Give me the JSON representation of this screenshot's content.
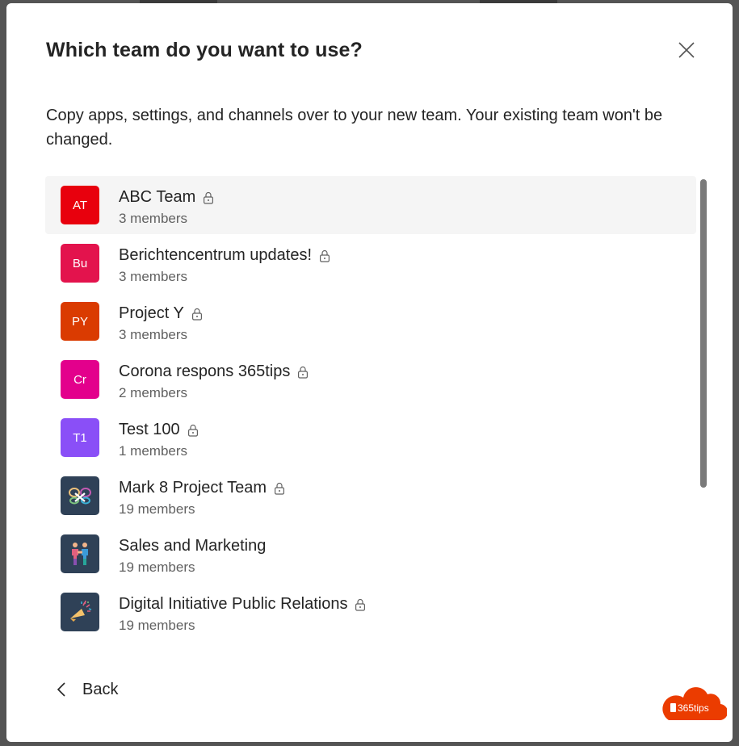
{
  "dialog": {
    "title": "Which team do you want to use?",
    "description": "Copy apps, settings, and channels over to your new team. Your existing team won't be changed.",
    "close_icon": "close-icon",
    "back_label": "Back",
    "back_icon": "chevron-left-icon"
  },
  "teams": [
    {
      "name": "ABC Team",
      "members": "3 members",
      "initials": "AT",
      "color": "#e8000d",
      "private": true,
      "selected": true
    },
    {
      "name": "Berichtencentrum updates!",
      "members": "3 members",
      "initials": "Bu",
      "color": "#e3134d",
      "private": true
    },
    {
      "name": "Project Y",
      "members": "3 members",
      "initials": "PY",
      "color": "#da3b01",
      "private": true
    },
    {
      "name": "Corona respons 365tips",
      "members": "2 members",
      "initials": "Cr",
      "color": "#e3008c",
      "private": true
    },
    {
      "name": "Test 100",
      "members": "1 members",
      "initials": "T1",
      "color": "#8a4ff7",
      "private": true
    },
    {
      "name": "Mark 8 Project Team",
      "members": "19 members",
      "icon": "butterfly-drone-icon",
      "color": "#2f4157",
      "private": true
    },
    {
      "name": "Sales and Marketing",
      "members": "19 members",
      "icon": "handshake-people-icon",
      "color": "#2f4157",
      "private": false
    },
    {
      "name": "Digital Initiative Public Relations",
      "members": "19 members",
      "icon": "megaphone-icon",
      "color": "#2f4157",
      "private": true
    }
  ],
  "watermark": {
    "text": "365tips",
    "color": "#eb3c00"
  }
}
